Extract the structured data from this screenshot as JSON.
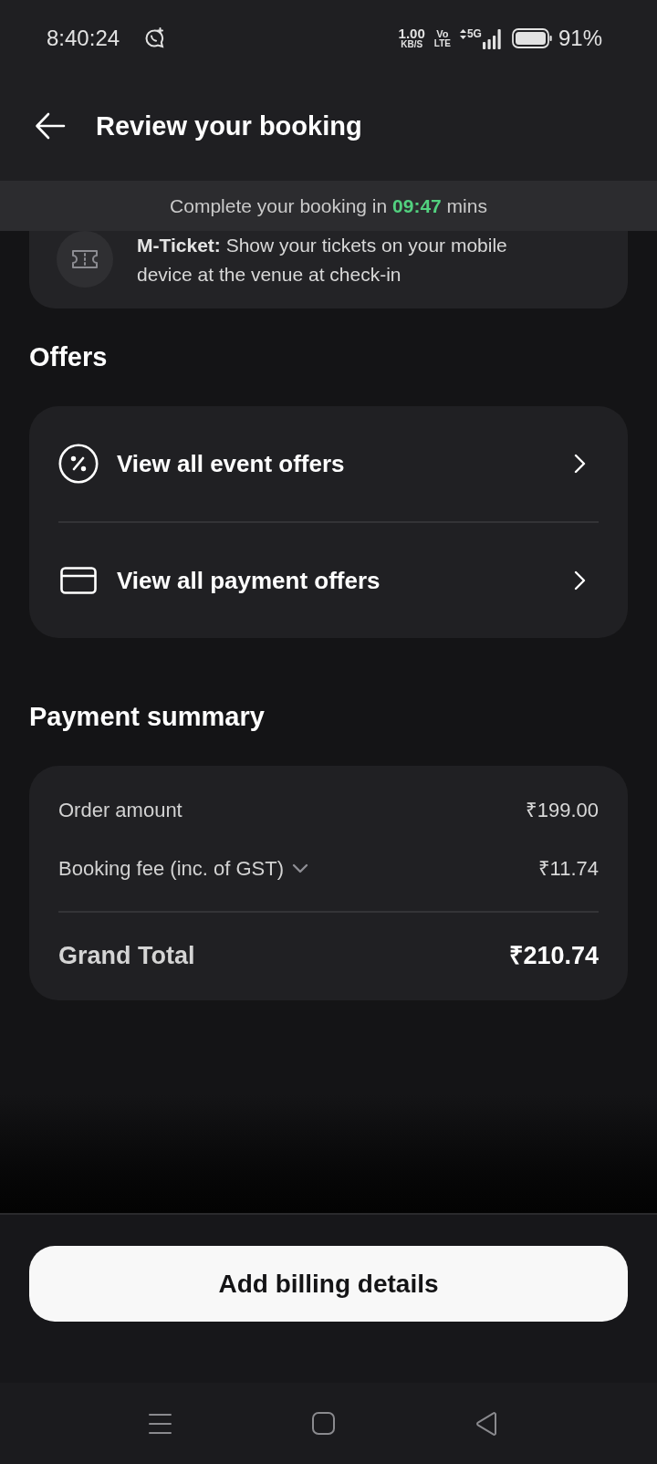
{
  "status_bar": {
    "time": "8:40:24",
    "net_speed": "1.00",
    "net_speed_unit": "KB/S",
    "volte_top": "Vo",
    "volte_bottom": "LTE",
    "network": "5G",
    "battery": "91%"
  },
  "header": {
    "title": "Review your booking"
  },
  "timer_banner": {
    "text": "Complete your booking in **09:47** mins"
  },
  "mticket": {
    "text": "**M-Ticket:** Show your tickets on your mobile device at the venue at check-in"
  },
  "offers": {
    "heading": "Offers",
    "items": [
      {
        "kind": "event",
        "label": "View all event offers"
      },
      {
        "kind": "payment",
        "label": "View all payment offers"
      }
    ]
  },
  "payment_summary": {
    "heading": "Payment summary",
    "rows": [
      {
        "label": "Order amount",
        "value": "₹199.00"
      },
      {
        "label": "Booking fee (inc. of GST)",
        "value": "₹11.74",
        "expanded": false
      }
    ],
    "total": {
      "label": "Grand Total",
      "value": "₹210.74"
    }
  },
  "footer": {
    "button": "Add billing details"
  }
}
